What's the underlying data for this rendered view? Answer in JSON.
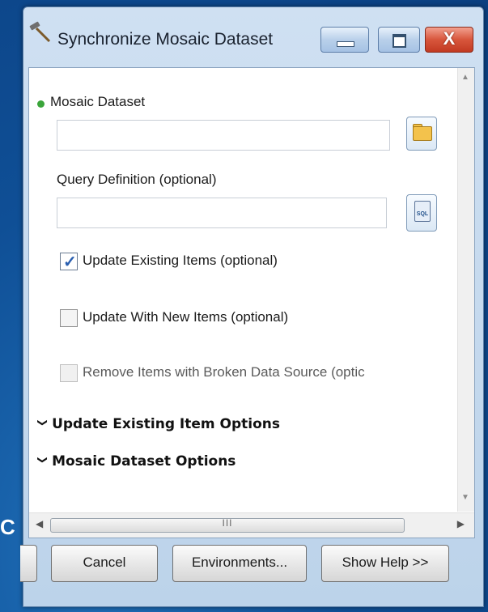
{
  "background_text": "C",
  "window": {
    "title": "Synchronize Mosaic Dataset",
    "icons": {
      "title": "hammer-icon",
      "minimize": "minimize-icon",
      "maximize": "maximize-icon",
      "close": "close-icon"
    },
    "close_glyph": "X"
  },
  "form": {
    "mosaic_dataset_label": "Mosaic Dataset",
    "mosaic_dataset_value": "",
    "query_definition_label": "Query Definition (optional)",
    "query_definition_value": "",
    "sql_icon_text": "SQL",
    "checkboxes": [
      {
        "label": "Update Existing Items (optional)",
        "checked": true,
        "enabled": true
      },
      {
        "label": "Update With New Items (optional)",
        "checked": false,
        "enabled": true
      },
      {
        "label": "Remove Items with Broken Data Source (optic",
        "checked": false,
        "enabled": false
      }
    ],
    "sections": [
      {
        "label": "Update Existing Item Options",
        "expanded": false
      },
      {
        "label": "Mosaic Dataset Options",
        "expanded": false
      }
    ],
    "scroll_grip": "III"
  },
  "footer": {
    "cancel": "Cancel",
    "environments": "Environments...",
    "show_help": "Show Help >>"
  },
  "colors": {
    "accent": "#2a5fb0",
    "required_dot": "#3aa53a",
    "desktop": "#0f4f96"
  }
}
